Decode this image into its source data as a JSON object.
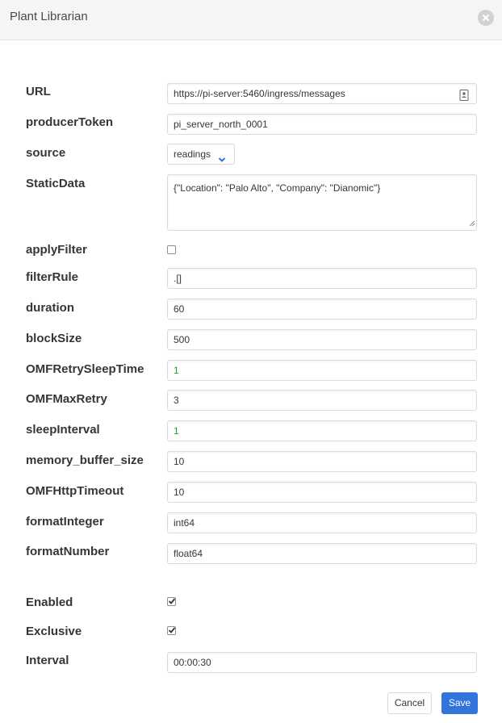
{
  "modal": {
    "title": "Plant Librarian"
  },
  "fields": {
    "url": {
      "label": "URL",
      "value": "https://pi-server:5460/ingress/messages"
    },
    "producerToken": {
      "label": "producerToken",
      "value": "pi_server_north_0001"
    },
    "source": {
      "label": "source",
      "value": "readings"
    },
    "staticData": {
      "label": "StaticData",
      "value": "{\"Location\": \"Palo Alto\", \"Company\": \"Dianomic\"}"
    },
    "applyFilter": {
      "label": "applyFilter",
      "checked": false
    },
    "filterRule": {
      "label": "filterRule",
      "value": ".[]"
    },
    "duration": {
      "label": "duration",
      "value": "60"
    },
    "blockSize": {
      "label": "blockSize",
      "value": "500"
    },
    "omfRetrySleepTime": {
      "label": "OMFRetrySleepTime",
      "value": "1"
    },
    "omfMaxRetry": {
      "label": "OMFMaxRetry",
      "value": "3"
    },
    "sleepInterval": {
      "label": "sleepInterval",
      "value": "1"
    },
    "memoryBufferSize": {
      "label": "memory_buffer_size",
      "value": "10"
    },
    "omfHttpTimeout": {
      "label": "OMFHttpTimeout",
      "value": "10"
    },
    "formatInteger": {
      "label": "formatInteger",
      "value": "int64"
    },
    "formatNumber": {
      "label": "formatNumber",
      "value": "float64"
    }
  },
  "schedule": {
    "enabled": {
      "label": "Enabled",
      "checked": true
    },
    "exclusive": {
      "label": "Exclusive",
      "checked": true
    },
    "interval": {
      "label": "Interval",
      "value": "00:00:30"
    }
  },
  "footer": {
    "cancel_label": "Cancel",
    "save_label": "Save"
  },
  "colors": {
    "accent": "#3273dc",
    "numeric_text": "#23a127",
    "header_bg": "#f5f5f5"
  },
  "icons": {
    "close": "close-icon",
    "url_field": "contact-card-icon",
    "select": "chevron-down-icon"
  }
}
